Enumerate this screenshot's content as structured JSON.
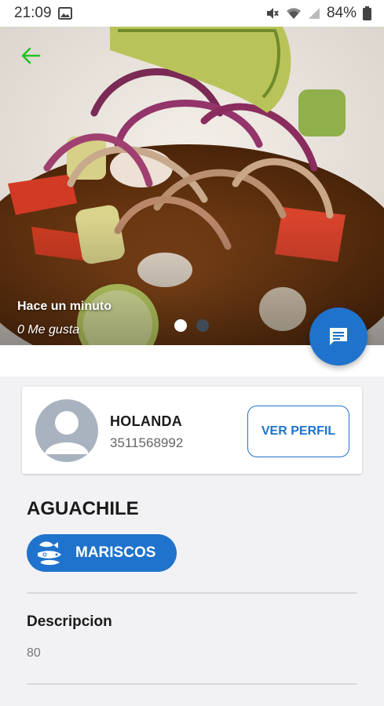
{
  "status_bar": {
    "time": "21:09",
    "battery": "84%",
    "icons": [
      "image-icon",
      "mute-icon",
      "wifi-icon",
      "signal-icon",
      "battery-icon"
    ]
  },
  "hero": {
    "time_text": "Hace un minuto",
    "likes_text": "0 Me gusta",
    "carousel_count": 2,
    "carousel_active": 0
  },
  "profile": {
    "name": "HOLANDA",
    "phone": "3511568992",
    "button_label": "VER PERFIL"
  },
  "dish": {
    "title": "AGUACHILE",
    "category": "MARISCOS",
    "category_icon": "seafood-icon"
  },
  "description": {
    "heading": "Descripcion",
    "value": "80"
  },
  "colors": {
    "primary": "#1f73cc",
    "back_arrow": "#22c322",
    "background": "#f2f2f4"
  }
}
